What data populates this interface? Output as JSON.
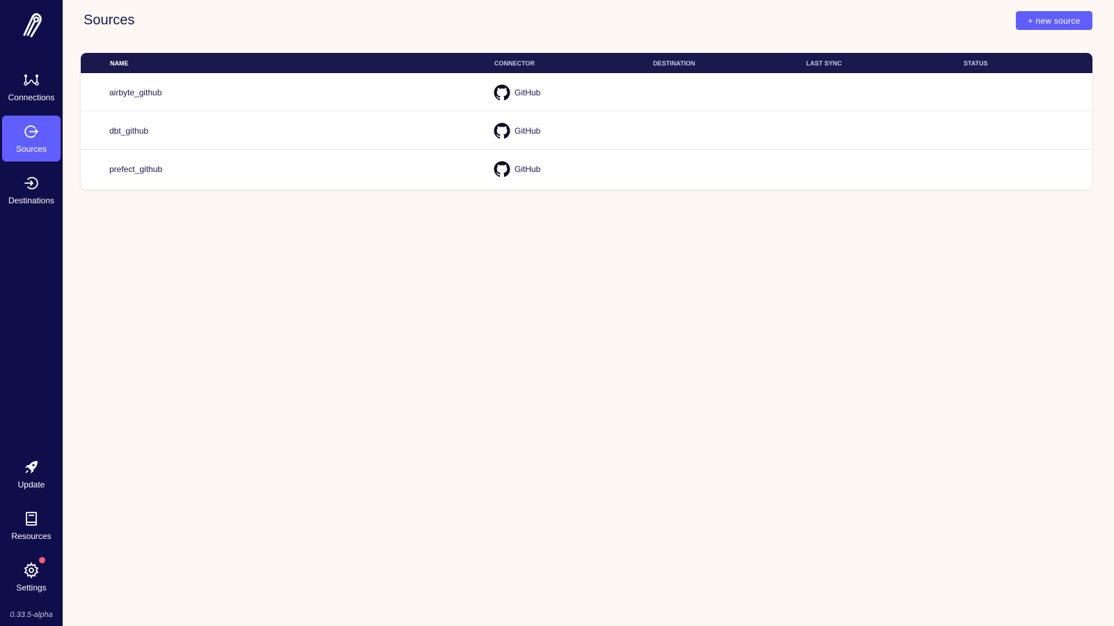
{
  "sidebar": {
    "nav_top": [
      {
        "label": "Connections",
        "icon": "connections-icon"
      },
      {
        "label": "Sources",
        "icon": "sources-icon",
        "active": true
      },
      {
        "label": "Destinations",
        "icon": "destinations-icon"
      }
    ],
    "nav_bottom": [
      {
        "label": "Update",
        "icon": "rocket-icon"
      },
      {
        "label": "Resources",
        "icon": "book-icon"
      },
      {
        "label": "Settings",
        "icon": "gear-icon",
        "notification": true
      }
    ],
    "version": "0.33.5-alpha"
  },
  "header": {
    "title": "Sources",
    "new_button_label": "+ new source"
  },
  "table": {
    "columns": [
      "NAME",
      "CONNECTOR",
      "DESTINATION",
      "LAST SYNC",
      "STATUS"
    ],
    "rows": [
      {
        "name": "airbyte_github",
        "connector": "GitHub",
        "connector_icon": "github-icon"
      },
      {
        "name": "dbt_github",
        "connector": "GitHub",
        "connector_icon": "github-icon"
      },
      {
        "name": "prefect_github",
        "connector": "GitHub",
        "connector_icon": "github-icon"
      }
    ]
  },
  "colors": {
    "sidebar_bg": "#0f0d4a",
    "accent": "#615eff",
    "table_header_bg": "#1a194d",
    "page_bg": "#fdf8f4",
    "notification": "#ff5e7b"
  }
}
